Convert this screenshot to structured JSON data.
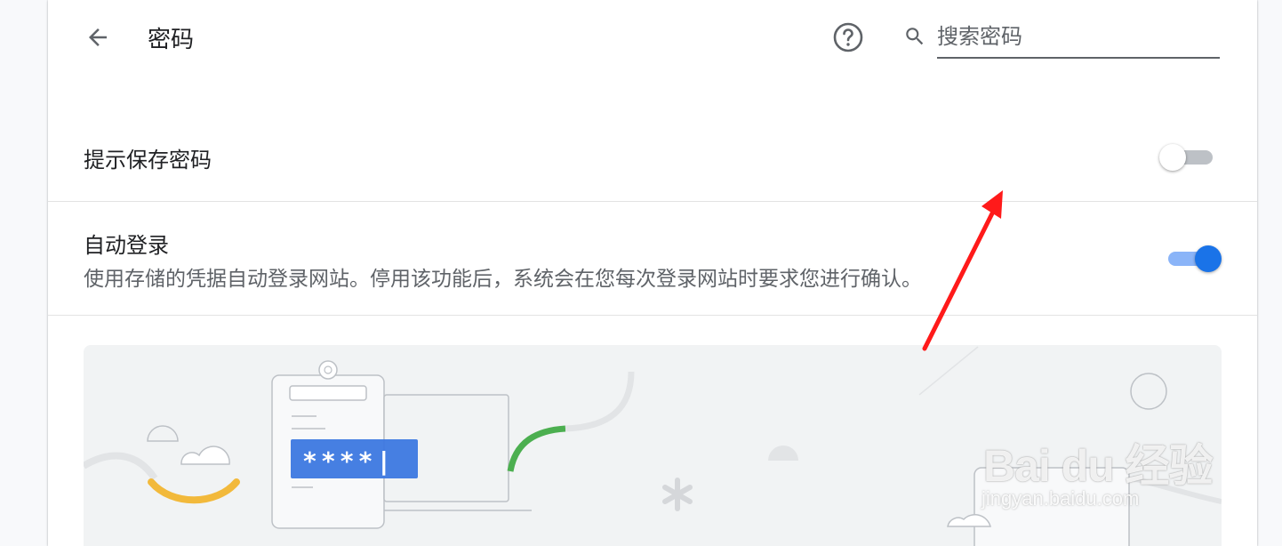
{
  "header": {
    "back_icon": "arrow-back-icon",
    "title": "密码",
    "help_icon": "help-circle-icon",
    "search": {
      "icon": "search-icon",
      "placeholder": "搜索密码",
      "value": ""
    }
  },
  "settings": {
    "offer_to_save": {
      "label": "提示保存密码",
      "enabled": false
    },
    "auto_signin": {
      "label": "自动登录",
      "description": "使用存储的凭据自动登录网站。停用该功能后，系统会在您每次登录网站时要求您进行确认。",
      "enabled": true
    }
  },
  "illustration": {
    "password_mask": "****|"
  },
  "watermark": {
    "logo": "Bai du 经验",
    "url": "jingyan.baidu.com"
  },
  "colors": {
    "accent": "#1a73e8",
    "annotation": "#ff1a1a",
    "yellow": "#f2b93b",
    "green": "#4caf50"
  }
}
